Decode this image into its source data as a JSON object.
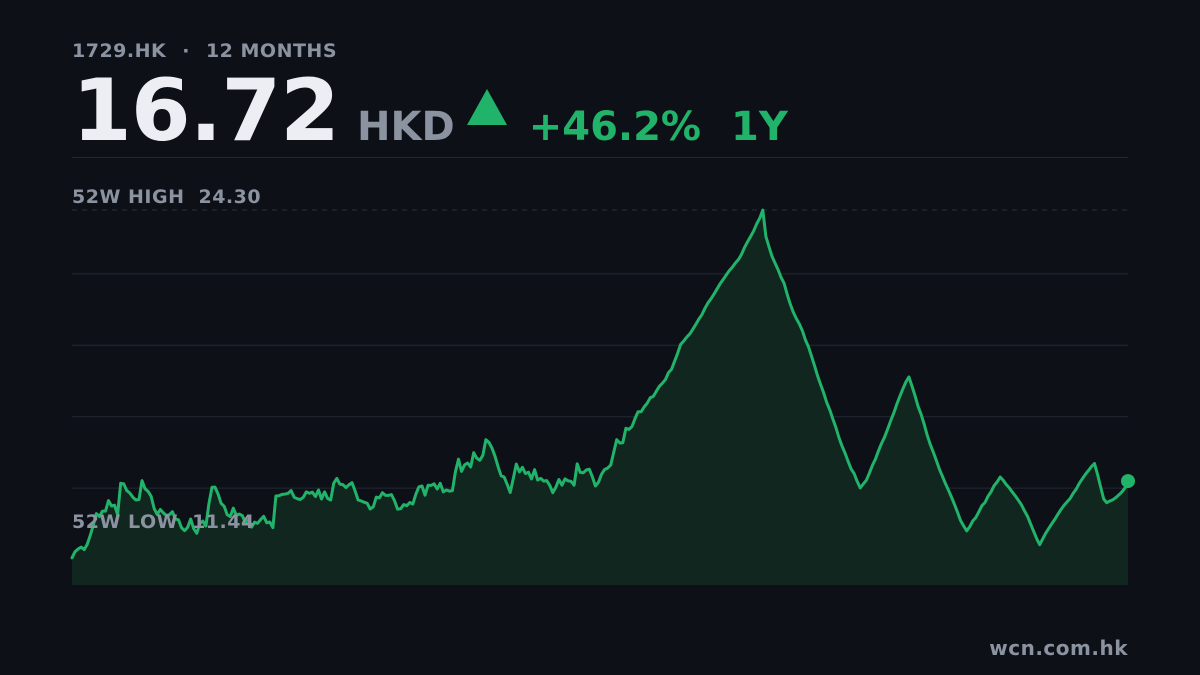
{
  "header": {
    "ticker": "1729.HK",
    "separator": "·",
    "range_label": "12 MONTHS"
  },
  "quote": {
    "price": "16.72",
    "currency": "HKD",
    "change": "+46.2%",
    "period": "1Y",
    "direction_icon": "up-triangle-icon"
  },
  "stats": {
    "high_label": "52W HIGH",
    "high_value": "24.30",
    "low_label": "52W LOW",
    "low_value": "11.44"
  },
  "watermark": "wcn.com.hk",
  "colors": {
    "background": "#0d1017",
    "up": "#22b36a",
    "muted": "#8b93a1",
    "grid": "#232833"
  },
  "chart_data": {
    "type": "area",
    "x_unit": "trading day (approx. 1 year)",
    "ylim": [
      10.44,
      24.3
    ],
    "grid_lines": [
      21.94,
      19.3,
      16.66,
      14.02
    ],
    "reference_lines": [
      24.3,
      11.44
    ],
    "values": [
      11.44,
      11.67,
      11.77,
      11.84,
      11.75,
      11.94,
      12.28,
      12.65,
      13.08,
      12.97,
      13.17,
      13.17,
      13.56,
      13.36,
      13.39,
      13.04,
      14.2,
      14.18,
      13.93,
      13.84,
      13.68,
      13.58,
      13.6,
      14.3,
      14.0,
      13.9,
      13.72,
      13.26,
      13.05,
      13.23,
      13.11,
      13.01,
      13.04,
      13.15,
      12.88,
      12.85,
      12.55,
      12.45,
      12.57,
      12.88,
      12.52,
      12.35,
      12.72,
      12.8,
      12.62,
      13.44,
      14.05,
      14.06,
      13.8,
      13.46,
      13.35,
      13.04,
      12.97,
      13.28,
      13.02,
      13.06,
      13.0,
      12.73,
      12.87,
      12.58,
      12.76,
      12.72,
      12.86,
      12.98,
      12.74,
      12.77,
      12.56,
      13.73,
      13.74,
      13.79,
      13.8,
      13.83,
      13.93,
      13.68,
      13.63,
      13.6,
      13.68,
      13.88,
      13.83,
      13.87,
      13.71,
      13.95,
      13.62,
      13.88,
      13.64,
      13.58,
      14.2,
      14.38,
      14.17,
      14.15,
      14.04,
      14.14,
      14.22,
      13.93,
      13.58,
      13.55,
      13.5,
      13.46,
      13.25,
      13.33,
      13.69,
      13.66,
      13.85,
      13.75,
      13.75,
      13.78,
      13.55,
      13.24,
      13.26,
      13.41,
      13.37,
      13.49,
      13.43,
      13.8,
      14.07,
      14.1,
      13.76,
      14.13,
      14.12,
      14.18,
      13.99,
      14.2,
      13.88,
      13.95,
      13.91,
      13.93,
      14.62,
      15.09,
      14.64,
      14.88,
      14.95,
      14.8,
      15.33,
      15.13,
      15.05,
      15.23,
      15.81,
      15.71,
      15.5,
      15.2,
      14.81,
      14.48,
      14.43,
      14.16,
      13.86,
      14.38,
      14.91,
      14.62,
      14.79,
      14.56,
      14.61,
      14.36,
      14.7,
      14.32,
      14.38,
      14.28,
      14.3,
      14.12,
      13.85,
      14.06,
      14.34,
      14.13,
      14.36,
      14.29,
      14.27,
      14.13,
      14.92,
      14.6,
      14.59,
      14.69,
      14.72,
      14.44,
      14.1,
      14.24,
      14.53,
      14.71,
      14.76,
      14.87,
      15.34,
      15.81,
      15.69,
      15.7,
      16.23,
      16.19,
      16.3,
      16.59,
      16.84,
      16.84,
      17.02,
      17.16,
      17.36,
      17.41,
      17.6,
      17.78,
      17.9,
      18.03,
      18.29,
      18.41,
      18.71,
      19.0,
      19.33,
      19.46,
      19.6,
      19.72,
      19.89,
      20.08,
      20.27,
      20.43,
      20.67,
      20.87,
      21.02,
      21.2,
      21.39,
      21.58,
      21.74,
      21.9,
      22.06,
      22.19,
      22.34,
      22.47,
      22.66,
      22.92,
      23.13,
      23.32,
      23.53,
      23.79,
      24.0,
      24.3,
      23.32,
      22.95,
      22.6,
      22.34,
      22.1,
      21.81,
      21.59,
      21.18,
      20.83,
      20.53,
      20.29,
      20.09,
      19.84,
      19.5,
      19.24,
      18.9,
      18.55,
      18.17,
      17.85,
      17.54,
      17.19,
      16.91,
      16.58,
      16.26,
      15.89,
      15.59,
      15.32,
      15.02,
      14.73,
      14.56,
      14.27,
      14.03,
      14.17,
      14.31,
      14.57,
      14.86,
      15.09,
      15.4,
      15.67,
      15.9,
      16.2,
      16.5,
      16.79,
      17.11,
      17.41,
      17.68,
      17.94,
      18.13,
      17.8,
      17.44,
      17.05,
      16.75,
      16.39,
      15.99,
      15.64,
      15.36,
      15.05,
      14.73,
      14.46,
      14.19,
      13.95,
      13.69,
      13.42,
      13.12,
      12.82,
      12.62,
      12.44,
      12.6,
      12.81,
      12.93,
      13.15,
      13.37,
      13.49,
      13.72,
      13.89,
      14.11,
      14.25,
      14.43,
      14.31,
      14.15,
      14.03,
      13.87,
      13.73,
      13.57,
      13.4,
      13.18,
      12.97,
      12.7,
      12.42,
      12.15,
      11.93,
      12.15,
      12.36,
      12.54,
      12.71,
      12.88,
      13.06,
      13.23,
      13.39,
      13.51,
      13.64,
      13.83,
      13.99,
      14.2,
      14.37,
      14.53,
      14.67,
      14.82,
      14.93,
      14.52,
      14.07,
      13.62,
      13.48,
      13.54,
      13.59,
      13.67,
      13.77,
      13.88,
      14.03,
      14.28
    ]
  }
}
